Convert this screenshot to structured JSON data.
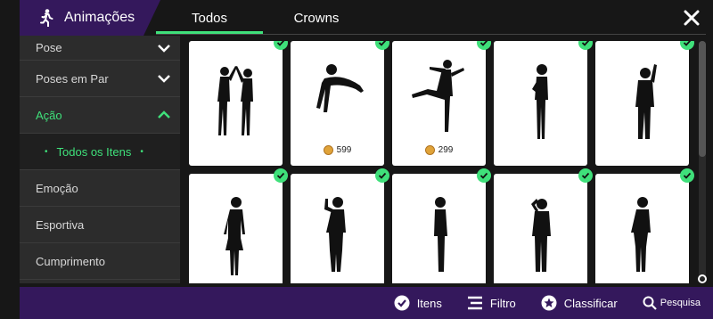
{
  "header": {
    "title": "Animações",
    "icon": "walking-person-icon"
  },
  "tabs": [
    {
      "label": "Todos",
      "active": true
    },
    {
      "label": "Crowns",
      "active": false
    }
  ],
  "sidebar": {
    "items": [
      {
        "label": "Pose",
        "chevron": "down"
      },
      {
        "label": "Poses em Par",
        "chevron": "down"
      },
      {
        "label": "Ação",
        "chevron": "up",
        "active": true
      },
      {
        "label": "Todos os Itens",
        "sub": true
      },
      {
        "label": "Emoção"
      },
      {
        "label": "Esportiva"
      },
      {
        "label": "Cumprimento"
      }
    ]
  },
  "cards": [
    {
      "pose": "pair-high-five",
      "owned": true,
      "price": null
    },
    {
      "pose": "push-up",
      "owned": true,
      "price": "599"
    },
    {
      "pose": "high-kick",
      "owned": true,
      "price": "299"
    },
    {
      "pose": "clapping",
      "owned": true,
      "price": null
    },
    {
      "pose": "wave",
      "owned": true,
      "price": null
    },
    {
      "pose": "standing-female",
      "owned": true,
      "price": null
    },
    {
      "pose": "female-finger-up",
      "owned": true,
      "price": null
    },
    {
      "pose": "standing-side",
      "owned": true,
      "price": null
    },
    {
      "pose": "hand-on-head",
      "owned": true,
      "price": null
    },
    {
      "pose": "hand-to-face",
      "owned": true,
      "price": null
    }
  ],
  "bottom": {
    "items_label": "Itens",
    "filter_label": "Filtro",
    "sort_label": "Classificar",
    "search_label": "Pesquisa"
  },
  "colors": {
    "accent": "#3fe07a",
    "purple": "#34185c",
    "panel": "#2c2c2c"
  }
}
